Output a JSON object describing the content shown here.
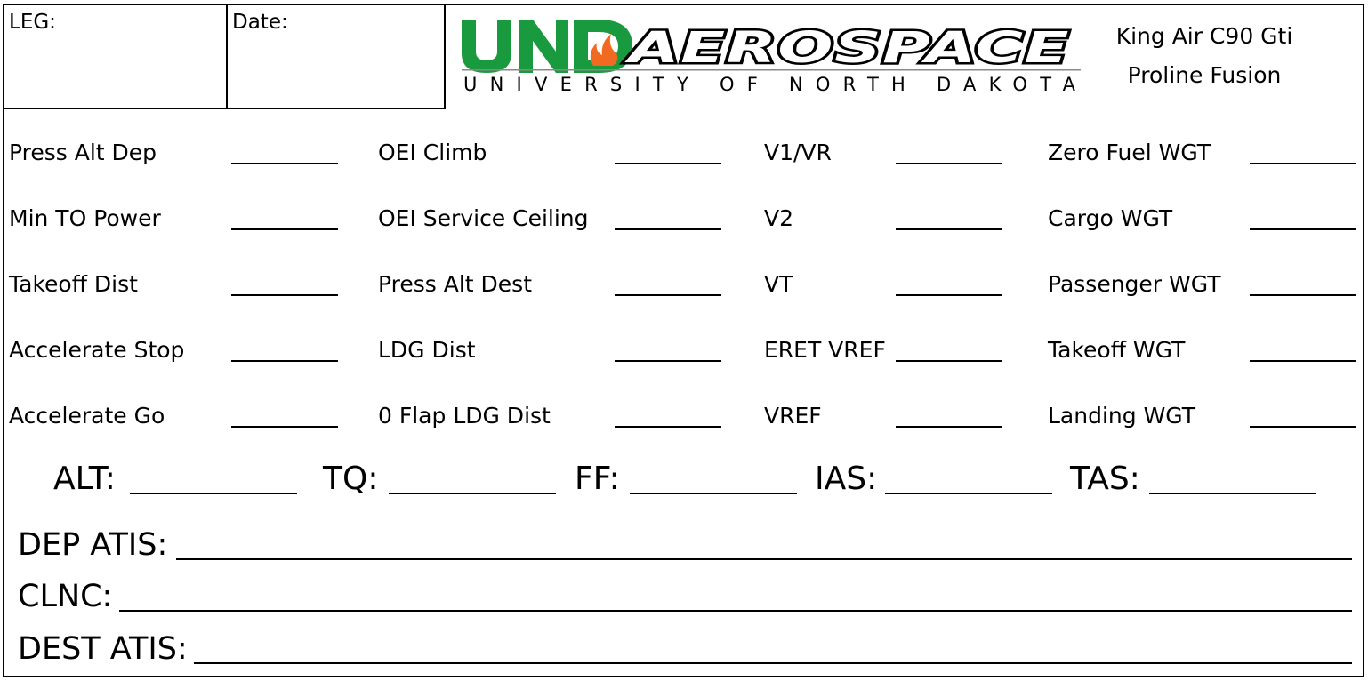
{
  "header": {
    "leg_label": "LEG:",
    "date_label": "Date:",
    "logo": {
      "und_text": "UND",
      "aerospace_text": "AEROSPACE",
      "university_text": "UNIVERSITY OF NORTH DAKOTA",
      "brand_green": "#1a9a3e",
      "flame_color": "#f26a21"
    },
    "aircraft_line1": "King Air C90 Gti",
    "aircraft_line2": "Proline Fusion"
  },
  "grid": {
    "col1": [
      "Press Alt Dep",
      "Min TO Power",
      "Takeoff Dist",
      "Accelerate Stop",
      "Accelerate Go"
    ],
    "col2": [
      "OEI Climb",
      "OEI Service Ceiling",
      "Press Alt Dest",
      "LDG Dist",
      "0 Flap LDG Dist"
    ],
    "col3": [
      "V1/VR",
      "V2",
      "VT",
      "ERET VREF",
      "VREF"
    ],
    "col4": [
      "Zero Fuel WGT",
      "Cargo WGT",
      "Passenger WGT",
      "Takeoff WGT",
      "Landing WGT"
    ]
  },
  "cruise": {
    "alt": "ALT:",
    "tq": "TQ:",
    "ff": "FF:",
    "ias": "IAS:",
    "tas": "TAS:"
  },
  "lines": {
    "dep_atis": "DEP ATIS:",
    "clnc": "CLNC:",
    "dest_atis": "DEST ATIS:"
  }
}
